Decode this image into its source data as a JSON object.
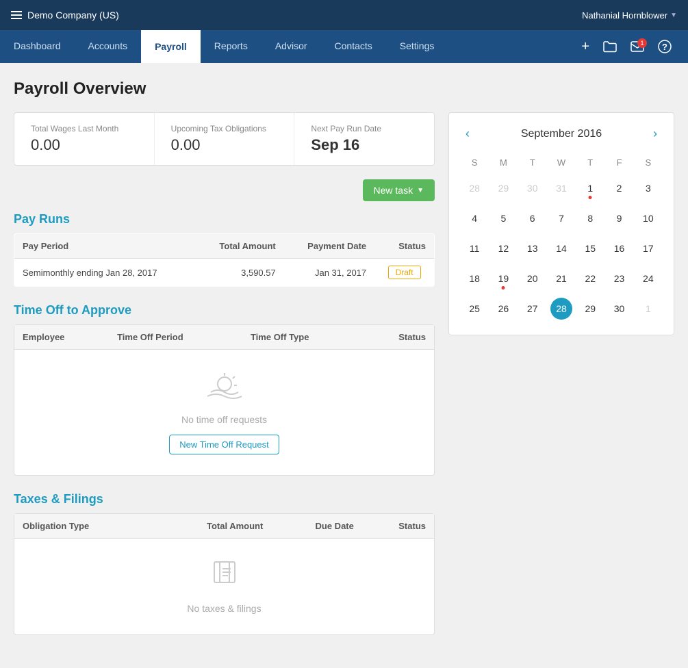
{
  "topbar": {
    "company": "Demo Company (US)",
    "username": "Nathanial Hornblower"
  },
  "nav": {
    "links": [
      {
        "label": "Dashboard",
        "active": false
      },
      {
        "label": "Accounts",
        "active": false
      },
      {
        "label": "Payroll",
        "active": true
      },
      {
        "label": "Reports",
        "active": false
      },
      {
        "label": "Advisor",
        "active": false
      },
      {
        "label": "Contacts",
        "active": false
      },
      {
        "label": "Settings",
        "active": false
      }
    ],
    "actions": {
      "add_label": "+",
      "folder_label": "📁",
      "mail_label": "✉",
      "mail_badge": "1",
      "help_label": "?"
    }
  },
  "page": {
    "title": "Payroll Overview"
  },
  "stats": [
    {
      "label": "Total Wages Last Month",
      "value": "0.00"
    },
    {
      "label": "Upcoming Tax Obligations",
      "value": "0.00"
    },
    {
      "label": "Next Pay Run Date",
      "value": "Sep 16",
      "bold": true
    }
  ],
  "new_task_label": "New task",
  "pay_runs": {
    "title": "Pay Runs",
    "columns": [
      "Pay Period",
      "Total Amount",
      "Payment Date",
      "Status"
    ],
    "rows": [
      {
        "pay_period": "Semimonthly ending Jan 28, 2017",
        "total_amount": "3,590.57",
        "payment_date": "Jan 31, 2017",
        "status": "Draft"
      }
    ]
  },
  "time_off": {
    "title": "Time Off to Approve",
    "columns": [
      "Employee",
      "Time Off Period",
      "Time Off Type",
      "Status"
    ],
    "empty_text": "No time off requests",
    "action_label": "New Time Off Request"
  },
  "taxes": {
    "title": "Taxes & Filings",
    "columns": [
      "Obligation Type",
      "Total Amount",
      "Due Date",
      "Status"
    ],
    "empty_text": "No taxes & filings"
  },
  "calendar": {
    "title": "September 2016",
    "days": [
      "S",
      "M",
      "T",
      "W",
      "T",
      "F",
      "S"
    ],
    "weeks": [
      [
        {
          "day": "28",
          "other": true
        },
        {
          "day": "29",
          "other": true
        },
        {
          "day": "30",
          "other": true
        },
        {
          "day": "31",
          "other": true
        },
        {
          "day": "1",
          "dot": true
        },
        {
          "day": "2"
        },
        {
          "day": "3"
        }
      ],
      [
        {
          "day": "4"
        },
        {
          "day": "5"
        },
        {
          "day": "6"
        },
        {
          "day": "7"
        },
        {
          "day": "8"
        },
        {
          "day": "9"
        },
        {
          "day": "10"
        }
      ],
      [
        {
          "day": "11"
        },
        {
          "day": "12"
        },
        {
          "day": "13"
        },
        {
          "day": "14"
        },
        {
          "day": "15"
        },
        {
          "day": "16"
        },
        {
          "day": "17"
        }
      ],
      [
        {
          "day": "18"
        },
        {
          "day": "19",
          "dot": true
        },
        {
          "day": "20"
        },
        {
          "day": "21"
        },
        {
          "day": "22"
        },
        {
          "day": "23"
        },
        {
          "day": "24"
        }
      ],
      [
        {
          "day": "25"
        },
        {
          "day": "26"
        },
        {
          "day": "27"
        },
        {
          "day": "28",
          "today": true
        },
        {
          "day": "29"
        },
        {
          "day": "30"
        },
        {
          "day": "1",
          "other": true
        }
      ]
    ]
  }
}
